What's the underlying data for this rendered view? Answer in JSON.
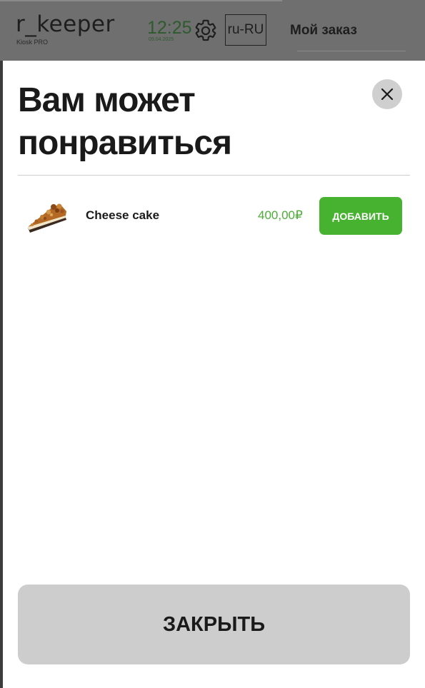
{
  "header": {
    "logo": "r_keeper",
    "logo_sub": "Kiosk PRO",
    "time": "12:25",
    "date": "09.04.2025",
    "language": "ru-RU",
    "my_order": "Мой заказ"
  },
  "modal": {
    "title": "Вам может понравиться",
    "close_icon": "close-icon",
    "items": [
      {
        "name": "Cheese cake",
        "price": "400,00₽",
        "add_label": "ДОБАВИТЬ",
        "image_icon": "cheesecake-image"
      }
    ],
    "close_label": "ЗАКРЫТЬ"
  },
  "colors": {
    "accent_green": "#46b22f",
    "price_green": "#4cae36",
    "overlay_gray": "#6f6f6f",
    "close_button_gray": "#cdcdcd"
  }
}
